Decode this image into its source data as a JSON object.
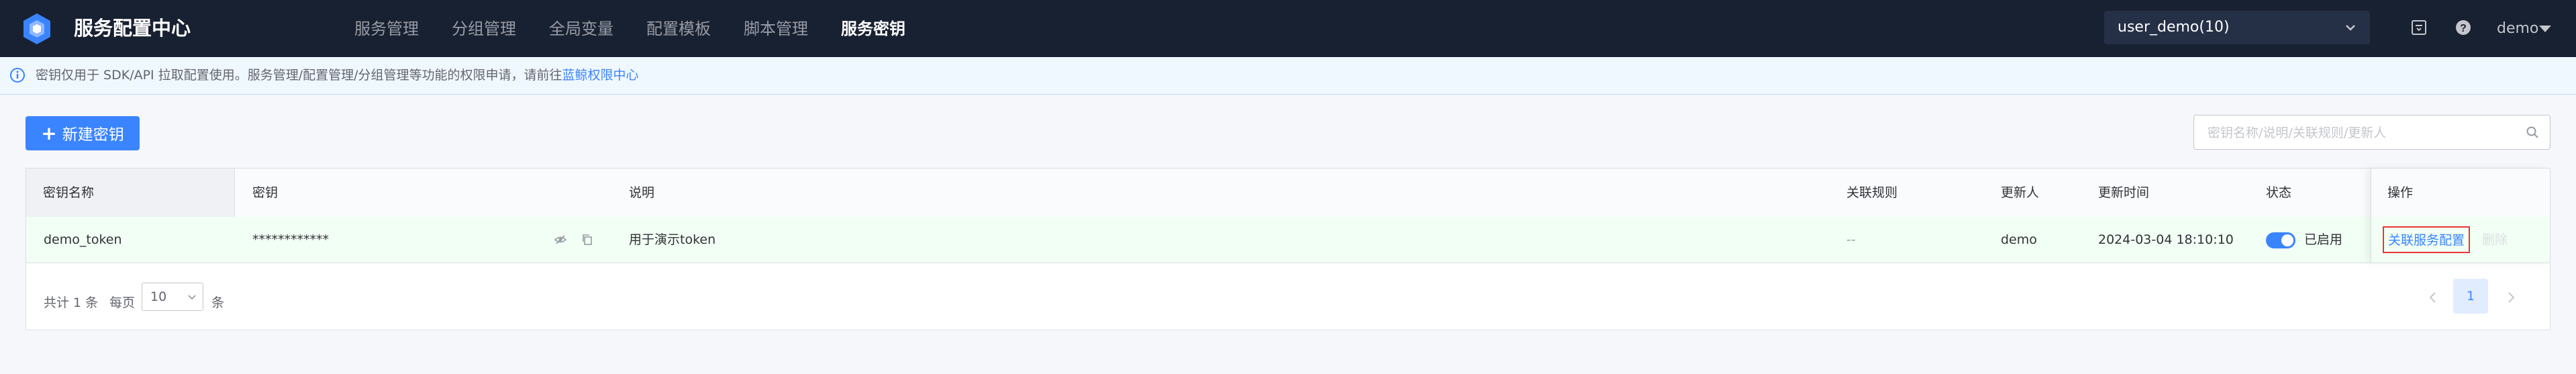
{
  "app": {
    "title": "服务配置中心"
  },
  "nav": {
    "items": [
      {
        "label": "服务管理"
      },
      {
        "label": "分组管理"
      },
      {
        "label": "全局变量"
      },
      {
        "label": "配置模板"
      },
      {
        "label": "脚本管理"
      },
      {
        "label": "服务密钥",
        "active": true
      }
    ]
  },
  "header": {
    "business_select": "user_demo(10)",
    "user": "demo",
    "icons": [
      "document-icon",
      "help-icon"
    ]
  },
  "notice": {
    "text": "密钥仅用于 SDK/API 拉取配置使用。服务管理/配置管理/分组管理等功能的权限申请，请前往",
    "link": "蓝鲸权限中心"
  },
  "toolbar": {
    "create_label": "新建密钥",
    "search_placeholder": "密钥名称/说明/关联规则/更新人"
  },
  "table": {
    "columns": [
      "密钥名称",
      "密钥",
      "说明",
      "关联规则",
      "更新人",
      "更新时间",
      "状态",
      "操作"
    ],
    "rows": [
      {
        "name": "demo_token",
        "secret": "************",
        "description": "用于演示token",
        "rule": "--",
        "updater": "demo",
        "updated_at": "2024-03-04 18:10:10",
        "status": "已启用",
        "enabled": true,
        "action_link": "关联服务配置",
        "action_delete": "删除"
      }
    ]
  },
  "pager": {
    "total": "共计 1 条",
    "per_page_label": "每页",
    "page_size": "10",
    "unit": "条",
    "current_page": "1"
  },
  "colors": {
    "topbar": "#182132",
    "accent": "#3a84ff",
    "row_highlight": "#f2fff4",
    "notice_bg": "#f0f8ff",
    "focus_border": "#ea3636"
  }
}
